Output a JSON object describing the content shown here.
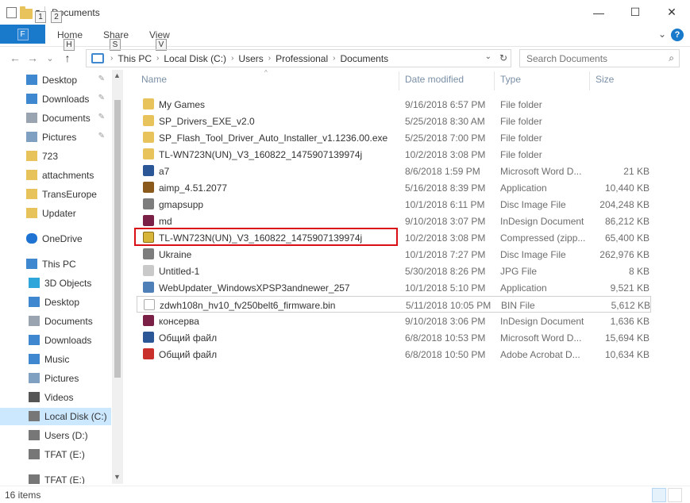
{
  "window": {
    "title": "Documents",
    "controls": {
      "minimize": "—",
      "maximize": "☐",
      "close": "✕"
    }
  },
  "quick_access": {
    "dropdown": "▾",
    "keytip_1": "1",
    "keytip_2": "2"
  },
  "ribbon": {
    "file_tab": "F",
    "tabs": [
      {
        "label": "Home",
        "keytip": "H"
      },
      {
        "label": "Share",
        "keytip": "S"
      },
      {
        "label": "View",
        "keytip": "V"
      }
    ],
    "collapse": "⌄",
    "help": "?"
  },
  "navigation": {
    "back": "←",
    "forward": "→",
    "recent": "⌄",
    "up": "↑",
    "breadcrumbs": [
      "This PC",
      "Local Disk (C:)",
      "Users",
      "Professional",
      "Documents"
    ],
    "separator": "›",
    "dropdown": "⌄",
    "refresh": "↻",
    "search_placeholder": "Search Documents",
    "search_icon": "⌕"
  },
  "sidebar": {
    "scroll_up": "▲",
    "scroll_down": "▼",
    "items": [
      {
        "label": "Desktop",
        "icon": "desktop-icon",
        "pinned": true
      },
      {
        "label": "Downloads",
        "icon": "downloads-icon",
        "pinned": true
      },
      {
        "label": "Documents",
        "icon": "documents-icon",
        "pinned": true
      },
      {
        "label": "Pictures",
        "icon": "pictures-icon",
        "pinned": true
      },
      {
        "label": "723",
        "icon": "folder-icon",
        "pinned": false
      },
      {
        "label": "attachments",
        "icon": "folder-icon",
        "pinned": false
      },
      {
        "label": "TransEurope",
        "icon": "folder-icon",
        "pinned": false
      },
      {
        "label": "Updater",
        "icon": "folder-icon",
        "pinned": false
      },
      {
        "label": "OneDrive",
        "icon": "onedrive-icon",
        "pinned": false
      },
      {
        "label": "This PC",
        "icon": "computer-icon",
        "pinned": false
      },
      {
        "label": "3D Objects",
        "icon": "3d-objects-icon",
        "pinned": false
      },
      {
        "label": "Desktop",
        "icon": "desktop-icon",
        "pinned": false
      },
      {
        "label": "Documents",
        "icon": "documents-icon",
        "pinned": false
      },
      {
        "label": "Downloads",
        "icon": "downloads-icon",
        "pinned": false
      },
      {
        "label": "Music",
        "icon": "music-icon",
        "pinned": false
      },
      {
        "label": "Pictures",
        "icon": "pictures-icon",
        "pinned": false
      },
      {
        "label": "Videos",
        "icon": "videos-icon",
        "pinned": false
      },
      {
        "label": "Local Disk (C:)",
        "icon": "drive-icon",
        "pinned": false,
        "selected": true
      },
      {
        "label": "Users (D:)",
        "icon": "drive-icon",
        "pinned": false
      },
      {
        "label": "TFAT (E:)",
        "icon": "drive-icon",
        "pinned": false
      },
      {
        "label": "TFAT (E:)",
        "icon": "drive-icon",
        "pinned": false
      }
    ],
    "pin_glyph": "✎"
  },
  "columns": {
    "name": "Name",
    "date": "Date modified",
    "type": "Type",
    "size": "Size",
    "sort_indicator": "^"
  },
  "files": [
    {
      "name": "My Games",
      "date": "9/16/2018 6:57 PM",
      "type": "File folder",
      "size": "",
      "icon": "ico-folder"
    },
    {
      "name": "SP_Drivers_EXE_v2.0",
      "date": "5/25/2018 8:30 AM",
      "type": "File folder",
      "size": "",
      "icon": "ico-folder"
    },
    {
      "name": "SP_Flash_Tool_Driver_Auto_Installer_v1.1236.00.exe",
      "date": "5/25/2018 7:00 PM",
      "type": "File folder",
      "size": "",
      "icon": "ico-folder"
    },
    {
      "name": "TL-WN723N(UN)_V3_160822_1475907139974j",
      "date": "10/2/2018 3:08 PM",
      "type": "File folder",
      "size": "",
      "icon": "ico-folder"
    },
    {
      "name": "a7",
      "date": "8/6/2018 1:59 PM",
      "type": "Microsoft Word D...",
      "size": "21 KB",
      "icon": "ico-word"
    },
    {
      "name": "aimp_4.51.2077",
      "date": "5/16/2018 8:39 PM",
      "type": "Application",
      "size": "10,440 KB",
      "icon": "ico-app"
    },
    {
      "name": "gmapsupp",
      "date": "10/1/2018 6:11 PM",
      "type": "Disc Image File",
      "size": "204,248 KB",
      "icon": "ico-disc"
    },
    {
      "name": "md",
      "date": "9/10/2018 3:07 PM",
      "type": "InDesign Document",
      "size": "86,212 KB",
      "icon": "ico-indd"
    },
    {
      "name": "TL-WN723N(UN)_V3_160822_1475907139974j",
      "date": "10/2/2018 3:08 PM",
      "type": "Compressed (zipp...",
      "size": "65,400 KB",
      "icon": "ico-zip"
    },
    {
      "name": "Ukraine",
      "date": "10/1/2018 7:27 PM",
      "type": "Disc Image File",
      "size": "262,976 KB",
      "icon": "ico-disc"
    },
    {
      "name": "Untitled-1",
      "date": "5/30/2018 8:26 PM",
      "type": "JPG File",
      "size": "8 KB",
      "icon": "ico-jpg"
    },
    {
      "name": "WebUpdater_WindowsXPSP3andnewer_257",
      "date": "10/1/2018 5:10 PM",
      "type": "Application",
      "size": "9,521 KB",
      "icon": "ico-app2"
    },
    {
      "name": "zdwh108n_hv10_fv250belt6_firmware.bin",
      "date": "5/11/2018 10:05 PM",
      "type": "BIN File",
      "size": "5,612 KB",
      "icon": "ico-bin",
      "outlined": true
    },
    {
      "name": "консерва",
      "date": "9/10/2018 3:06 PM",
      "type": "InDesign Document",
      "size": "1,636 KB",
      "icon": "ico-indd"
    },
    {
      "name": "Общий файл",
      "date": "6/8/2018 10:53 PM",
      "type": "Microsoft Word D...",
      "size": "15,694 KB",
      "icon": "ico-word"
    },
    {
      "name": "Общий файл",
      "date": "6/8/2018 10:50 PM",
      "type": "Adobe Acrobat D...",
      "size": "10,634 KB",
      "icon": "ico-pdf"
    }
  ],
  "highlighted_index": 8,
  "status": {
    "item_count": "16 items"
  },
  "colors": {
    "accent": "#1979ca",
    "highlight_border": "#d80f16",
    "selection": "#cce8ff"
  }
}
